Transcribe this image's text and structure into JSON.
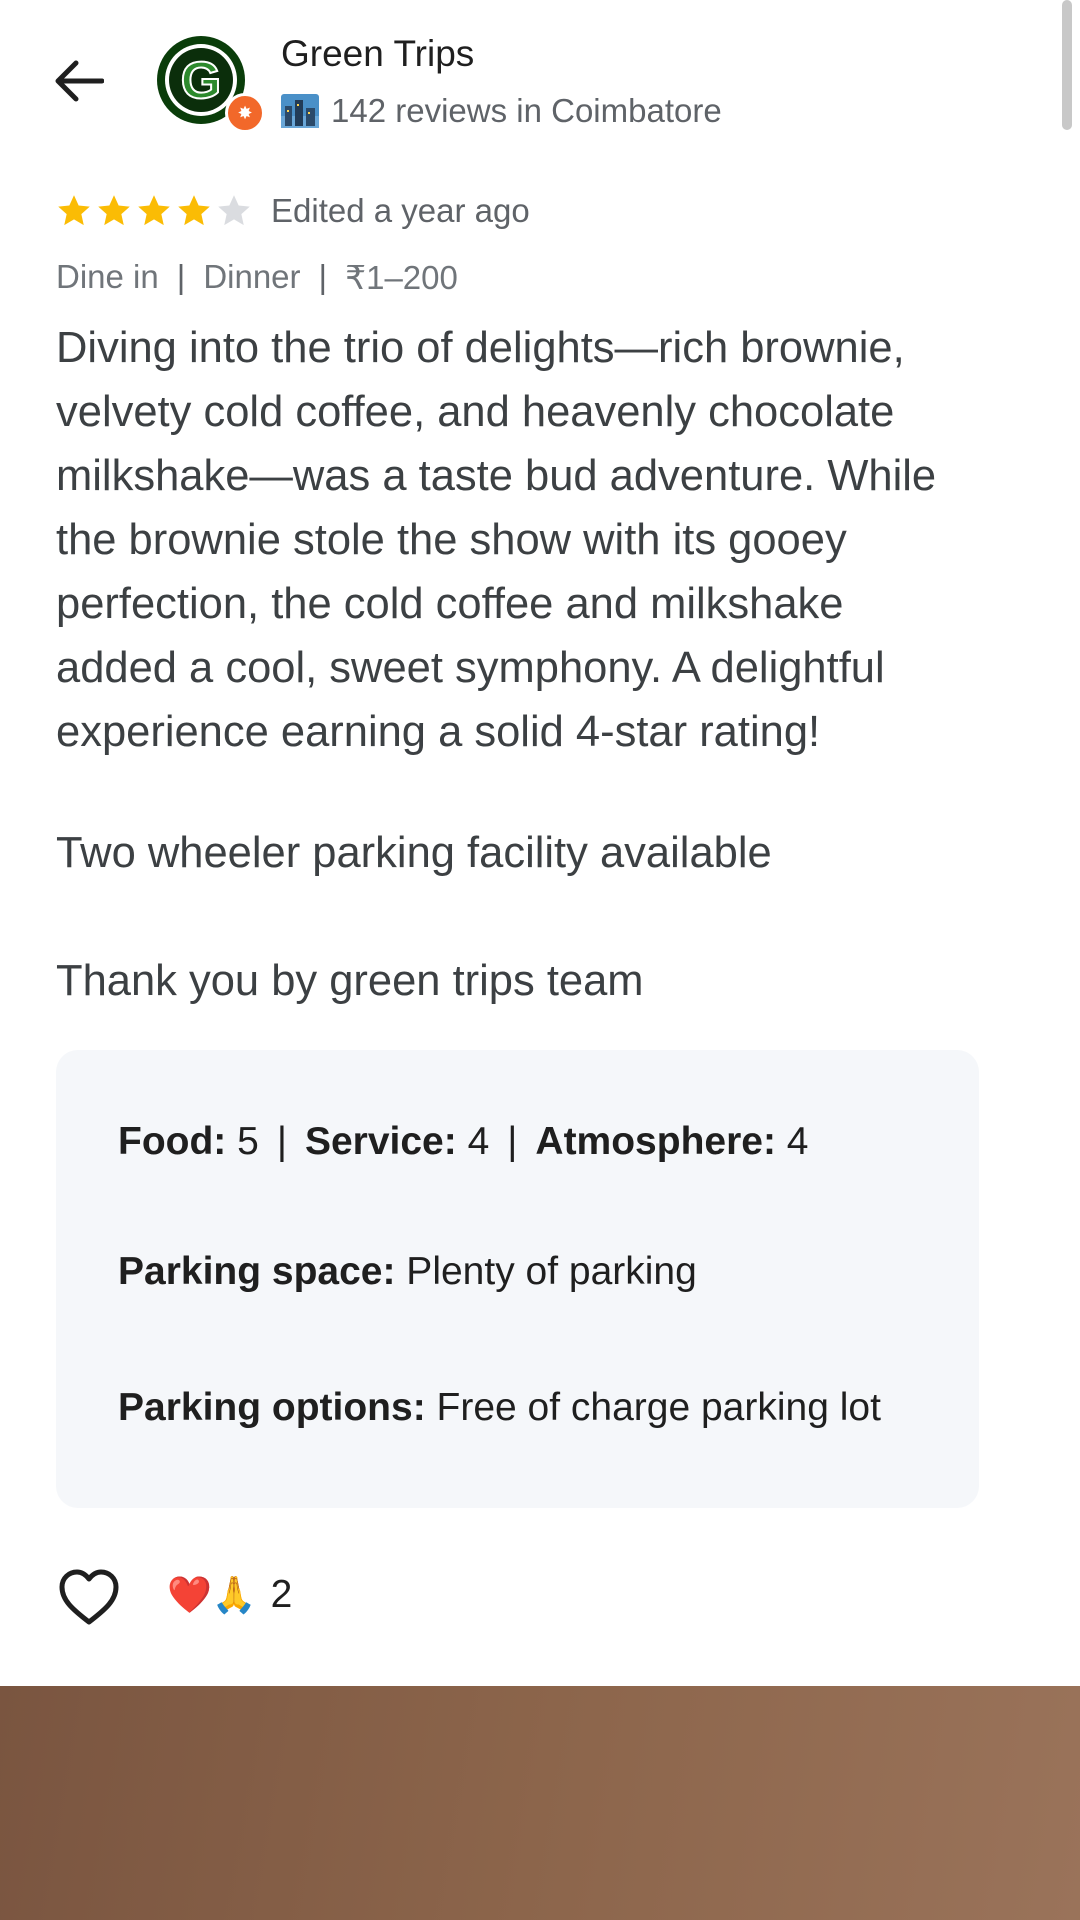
{
  "header": {
    "author_name": "Green Trips",
    "author_reviews": "142 reviews in Coimbatore",
    "avatar_letter": "G"
  },
  "review": {
    "rating": 4,
    "rating_max": 5,
    "edited": "Edited a year ago",
    "meta": [
      "Dine in",
      "Dinner",
      "₹1–200"
    ],
    "text_lines": [
      "Diving into the trio of delights—rich brownie,",
      "velvety cold coffee, and heavenly chocolate",
      "milkshake—was a taste bud adventure. While",
      "the brownie stole the show with its gooey",
      "perfection, the cold coffee and milkshake",
      "added a cool, sweet symphony. A delightful",
      "experience earning a solid 4-star rating!"
    ],
    "para2": "Two wheeler parking facility available",
    "para3": "Thank you by green trips team"
  },
  "attributes": {
    "food_label": "Food:",
    "food_value": " 5",
    "service_label": "Service:",
    "service_value": " 4",
    "atmosphere_label": "Atmosphere:",
    "atmosphere_value": " 4",
    "parking_space_label": "Parking space:",
    "parking_space_value": " Plenty of parking",
    "parking_options_label": "Parking options:",
    "parking_options_value": " Free of charge parking lot"
  },
  "reactions": {
    "emojis": "❤️🙏",
    "count": "2"
  },
  "colors": {
    "star_filled": "#fbbc04",
    "star_empty": "#dadce0",
    "badge": "#f2682a",
    "avatar_green": "#1e7a1e"
  },
  "icons": [
    "back-arrow-icon",
    "city-icon",
    "star-icon",
    "heart-outline-icon",
    "local-guide-badge-icon"
  ]
}
